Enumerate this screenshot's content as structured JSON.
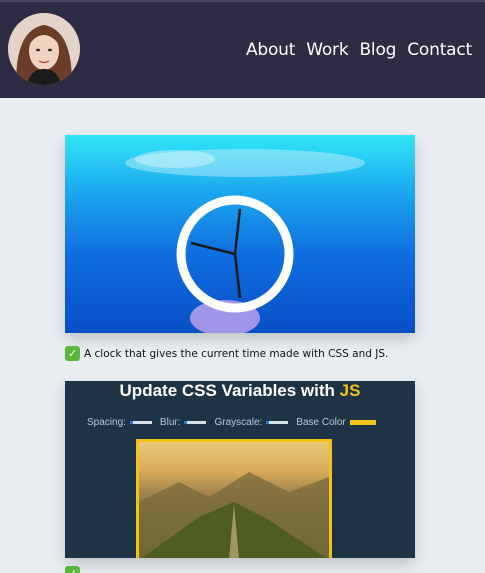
{
  "nav": {
    "links": [
      "About",
      "Work",
      "Blog",
      "Contact"
    ]
  },
  "projects": [
    {
      "check_icon": "check-mark-icon",
      "caption": "A clock that gives the current time made with CSS and JS."
    },
    {
      "title_prefix": "Update CSS Variables with ",
      "title_highlight": "JS",
      "controls": {
        "spacing": "Spacing:",
        "blur": "Blur:",
        "grayscale": "Grayscale:",
        "base_color": "Base Color"
      }
    }
  ],
  "colors": {
    "navbar": "#2e2b44",
    "background": "#e9eef2",
    "accent_yellow": "#f3c21b",
    "check_green": "#58b83a"
  }
}
